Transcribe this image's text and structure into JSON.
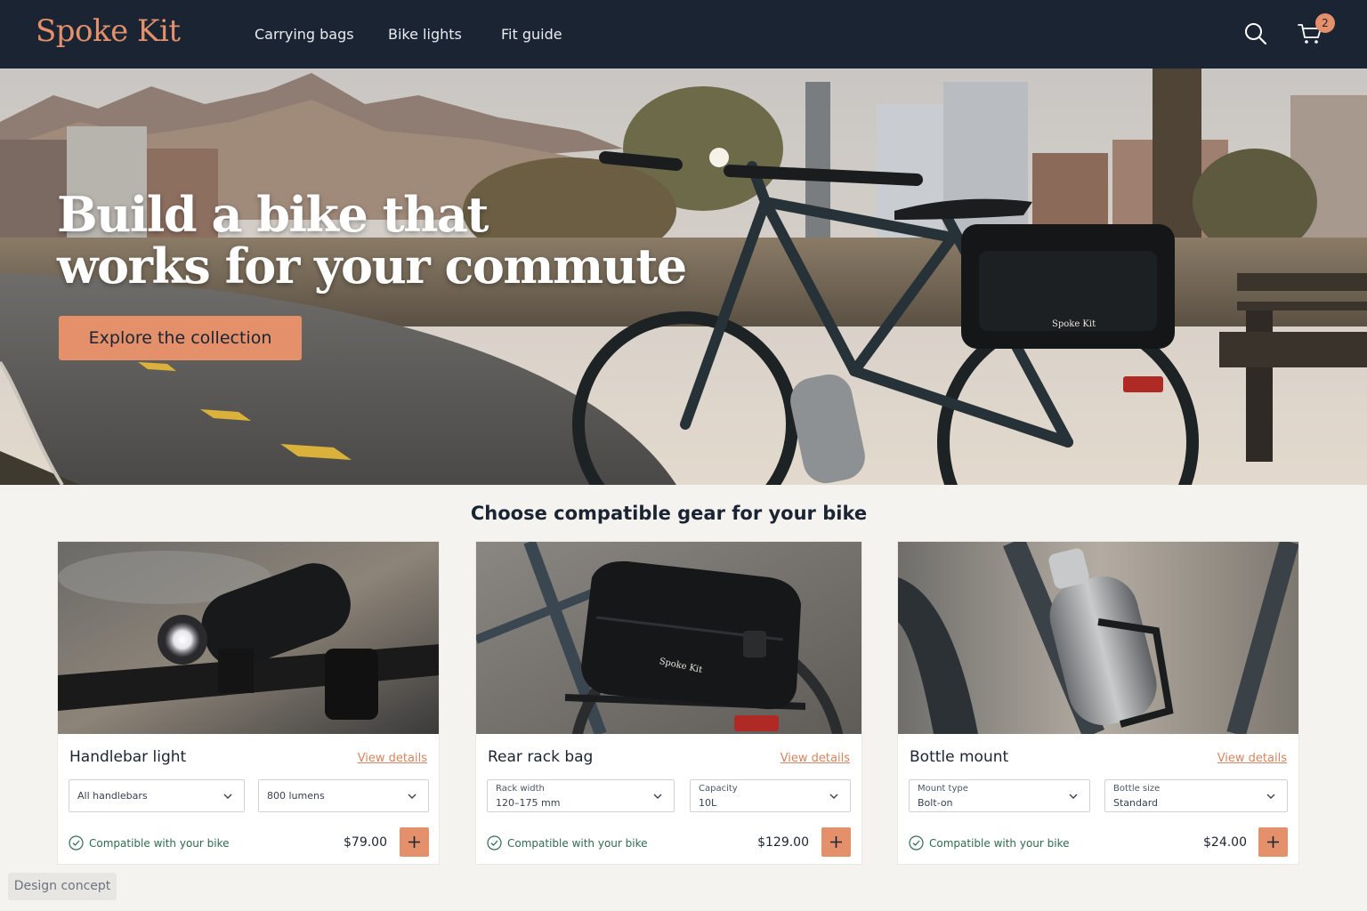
{
  "header": {
    "logo": "Spoke Kit",
    "nav": [
      "Carrying bags",
      "Bike lights",
      "Fit guide"
    ],
    "cart_count": "2",
    "icons": [
      "search-icon",
      "cart-icon"
    ]
  },
  "hero": {
    "title_line1": "Build a bike that",
    "title_line2": "works for your commute",
    "cta": "Explore the collection",
    "bag_brand": "Spoke Kit"
  },
  "section": {
    "title": "Choose compatible gear for your bike"
  },
  "products": [
    {
      "name": "Handlebar light",
      "view": "View details",
      "option1": "All handlebars",
      "option2": "800 lumens",
      "compat": "Compatible with your bike",
      "price": "$79.00"
    },
    {
      "name": "Rear rack bag",
      "view": "View details",
      "option1_label": "Rack width",
      "option1_value": "120–175 mm",
      "option2_label": "Capacity",
      "option2_value": "10L",
      "compat": "Compatible with your bike",
      "price": "$129.00",
      "bag_brand": "Spoke Kit"
    },
    {
      "name": "Bottle mount",
      "view": "View details",
      "option1_label": "Mount type",
      "option1_value": "Bolt-on",
      "option2_label": "Bottle size",
      "option2_value": "Standard",
      "compat": "Compatible with your bike",
      "price": "$24.00"
    }
  ],
  "footer_badge": "Design concept",
  "colors": {
    "header_bg": "#1b2433",
    "accent": "#e3906b",
    "success": "#2f6b4f",
    "page_bg": "#f5f3ef"
  }
}
